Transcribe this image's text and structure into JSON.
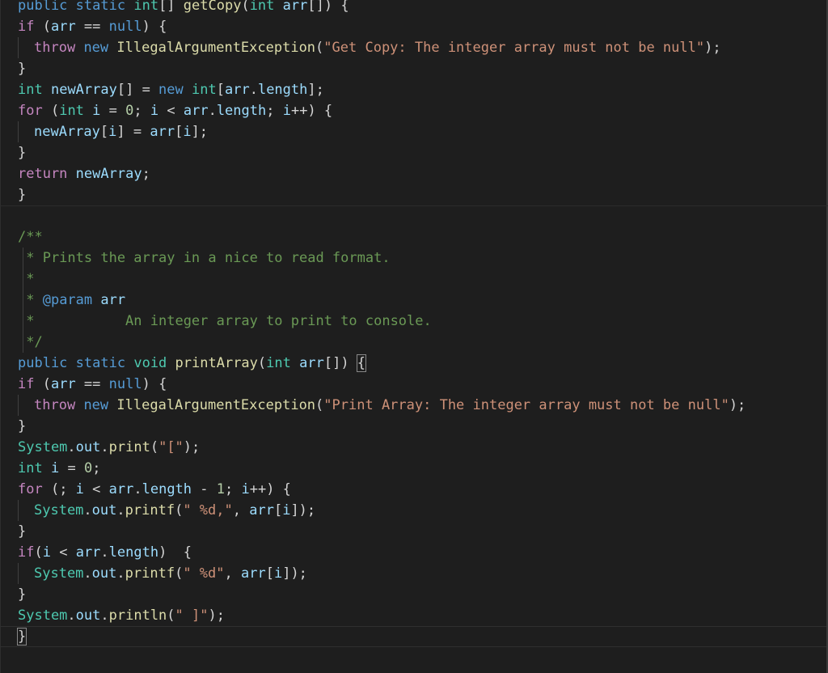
{
  "code": {
    "line_partial_top": "public static int[] getCopy(int arr[]) {",
    "getCopy": {
      "if_null": "if (arr == null) {",
      "throw": "throw new IllegalArgumentException(\"Get Copy: The integer array must not be null\");",
      "close1": "}",
      "decl": "int newArray[] = new int[arr.length];",
      "for": "for (int i = 0; i < arr.length; i++) {",
      "assign": "newArray[i] = arr[i];",
      "close2": "}",
      "return": "return newArray;",
      "close3": "}"
    },
    "javadoc": {
      "open": "/**",
      "desc": "* Prints the array in a nice to read format.",
      "star": "*",
      "param_tag": "@param",
      "param_name": "arr",
      "param_desc_star": "*",
      "param_desc": "An integer array to print to console.",
      "close": "*/"
    },
    "printArray": {
      "sig": "public static void printArray(int arr[]) {",
      "if_null": "if (arr == null) {",
      "throw": "throw new IllegalArgumentException(\"Print Array: The integer array must not be null\");",
      "close1": "}",
      "print_open": "System.out.print(\"[\");",
      "decl_i": "int i = 0;",
      "for": "for (; i < arr.length - 1; i++) {",
      "printf1": "System.out.printf(\" %d,\", arr[i]);",
      "close2": "}",
      "if_last": "if(i < arr.length)  {",
      "printf2": "System.out.printf(\" %d\", arr[i]);",
      "close3": "}",
      "println": "System.out.println(\" ]\");",
      "close4": "}"
    }
  }
}
